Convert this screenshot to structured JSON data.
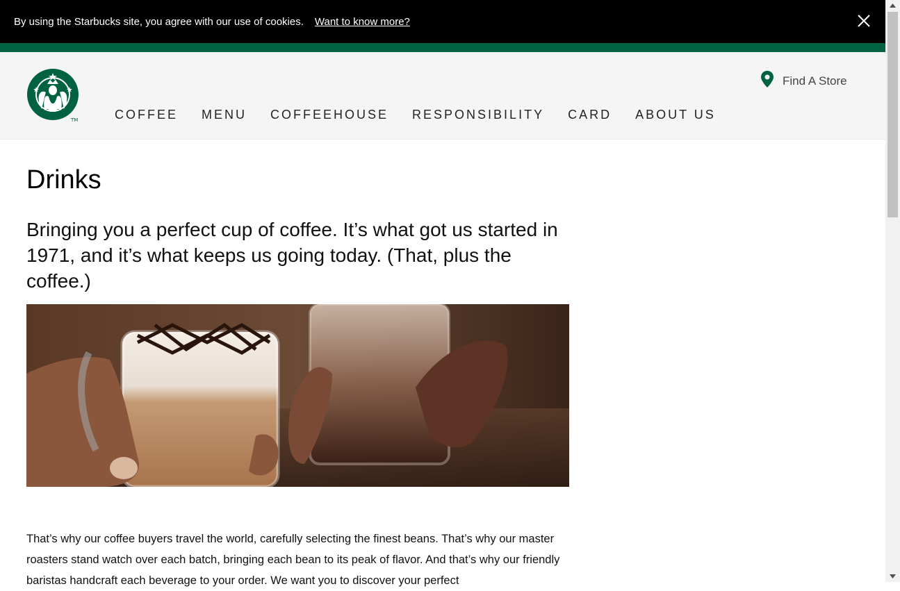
{
  "cookie_banner": {
    "message": "By using the Starbucks site, you agree with our use of cookies.",
    "link_label": "Want to know more?",
    "close_icon": "close-icon"
  },
  "header": {
    "logo_icon": "starbucks-siren-logo",
    "find_store_icon": "map-pin-icon",
    "find_store_label": "Find A Store",
    "nav": [
      "COFFEE",
      "MENU",
      "COFFEEHOUSE",
      "RESPONSIBILITY",
      "CARD",
      "ABOUT US"
    ]
  },
  "main": {
    "title": "Drinks",
    "lead": "Bringing you a perfect cup of coffee. It’s what got us started in 1971, and it’s what keeps us going today. (That, plus the coffee.)",
    "body": "That’s why our coffee buyers travel the world, carefully selecting the finest beans. That’s why our master roasters stand watch over each batch, bringing each bean to its peak of flavor. And that’s why our friendly baristas handcraft each beverage to your order. We want you to discover your perfect"
  },
  "colors": {
    "brand_green": "#006241",
    "banner_bg": "#000000",
    "header_bg": "#f5f5f5"
  }
}
